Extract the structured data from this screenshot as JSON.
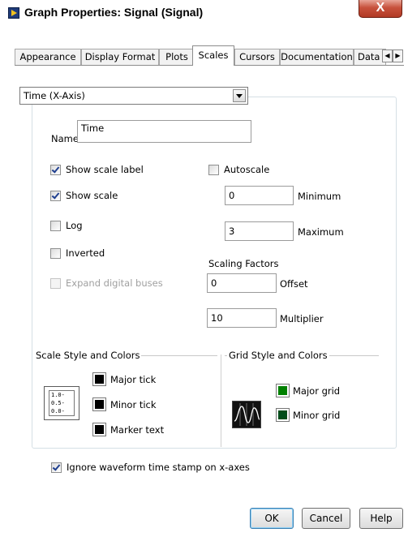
{
  "window": {
    "title": "Graph Properties: Signal (Signal)",
    "close_label": "X"
  },
  "tabs": [
    "Appearance",
    "Display Format",
    "Plots",
    "Scales",
    "Cursors",
    "Documentation",
    "Data"
  ],
  "active_tab": "Scales",
  "axis_select": {
    "value": "Time (X-Axis)"
  },
  "name": {
    "label": "Name",
    "value": "Time"
  },
  "options": {
    "show_scale_label": {
      "label": "Show scale label",
      "checked": true
    },
    "show_scale": {
      "label": "Show scale",
      "checked": true
    },
    "log": {
      "label": "Log",
      "checked": false
    },
    "inverted": {
      "label": "Inverted",
      "checked": false
    },
    "expand_digital_buses": {
      "label": "Expand digital buses",
      "checked": false,
      "disabled": true
    },
    "autoscale": {
      "label": "Autoscale",
      "checked": false
    }
  },
  "range": {
    "minimum": {
      "value": "0",
      "label": "Minimum"
    },
    "maximum": {
      "value": "3",
      "label": "Maximum"
    }
  },
  "scaling": {
    "title": "Scaling Factors",
    "offset": {
      "value": "0",
      "label": "Offset"
    },
    "multiplier": {
      "value": "10",
      "label": "Multiplier"
    }
  },
  "scale_style": {
    "title": "Scale Style and Colors",
    "icon_ticks": [
      "1.0",
      "0.5",
      "0.0"
    ],
    "major_tick": "Major tick",
    "minor_tick": "Minor tick",
    "marker_text": "Marker text",
    "colors": {
      "major_tick": "#000000",
      "minor_tick": "#000000",
      "marker_text": "#000000"
    }
  },
  "grid_style": {
    "title": "Grid Style and Colors",
    "major_grid": "Major grid",
    "minor_grid": "Minor grid",
    "colors": {
      "major_grid": "#008000",
      "minor_grid": "#004d1a"
    }
  },
  "ignore_timestamp": {
    "label": "Ignore waveform time stamp on x-axes",
    "checked": true
  },
  "buttons": {
    "ok": "OK",
    "cancel": "Cancel",
    "help": "Help"
  }
}
